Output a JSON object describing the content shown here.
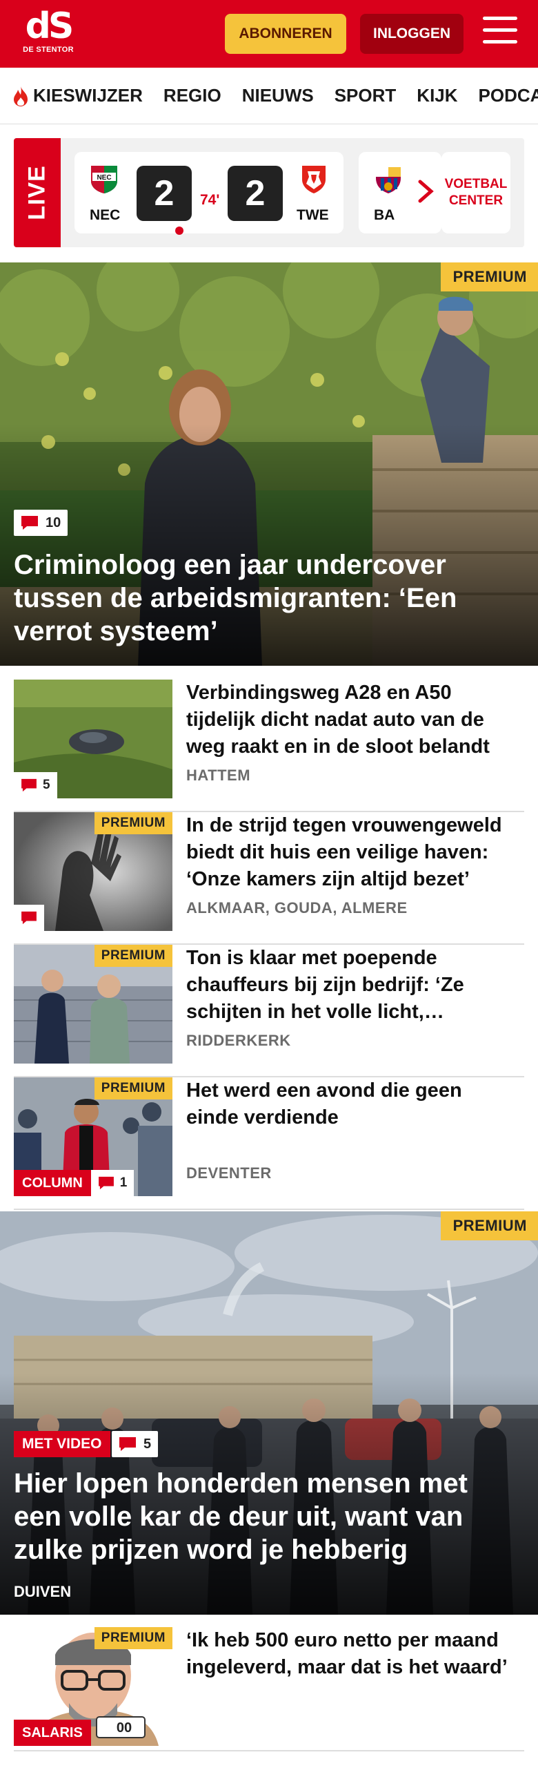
{
  "header": {
    "logo_text": "dS",
    "logo_sub": "DE STENTOR",
    "subscribe_label": "ABONNEREN",
    "login_label": "INLOGGEN"
  },
  "nav": {
    "items": [
      "KIESWIJZER",
      "REGIO",
      "NIEUWS",
      "SPORT",
      "KIJK",
      "PODCAST"
    ]
  },
  "live": {
    "tag": "LIVE",
    "match": {
      "home_code": "NEC",
      "away_code": "TWE",
      "home_score": "2",
      "away_score": "2",
      "minute": "74'"
    },
    "next_match_code": "BA",
    "center_label": "VOETBAL CENTER"
  },
  "hero1": {
    "premium": "PREMIUM",
    "comments": "10",
    "title": "Criminoloog een jaar undercover tussen de arbeidsmigranten: ‘Een verrot systeem’"
  },
  "articles": [
    {
      "title": "Verbindingsweg A28 en A50 tijdelijk dicht nadat auto van de weg raakt en in de sloot belandt",
      "meta": "HATTEM",
      "comments": "5"
    },
    {
      "premium": "PREMIUM",
      "title": "In de strijd tegen vrouwengeweld biedt dit huis een veilige haven: ‘Onze kamers zijn altijd bezet’",
      "meta": "ALKMAAR, GOUDA, ALMERE"
    },
    {
      "premium": "PREMIUM",
      "title": "Ton is klaar met poepende chauffeurs bij zijn bedrijf: ‘Ze schijten in het volle licht,…",
      "meta": "RIDDERKERK"
    },
    {
      "premium": "PREMIUM",
      "title": "Het werd een avond die geen einde verdiende",
      "meta": "DEVENTER",
      "label": "COLUMN",
      "comments": "1"
    }
  ],
  "hero2": {
    "premium": "PREMIUM",
    "video_label": "MET VIDEO",
    "comments": "5",
    "title": "Hier lopen honderden mensen met een volle kar de deur uit, want van zulke prijzen word je hebberig",
    "meta": "DUIVEN"
  },
  "article_last": {
    "premium": "PREMIUM",
    "title": "‘Ik heb 500 euro netto per maand ingeleverd, maar dat is het waard’",
    "label": "SALARIS"
  },
  "colors": {
    "brand_red": "#d9001b",
    "premium_yellow": "#f5c33b",
    "login_dark_red": "#a1000f"
  }
}
